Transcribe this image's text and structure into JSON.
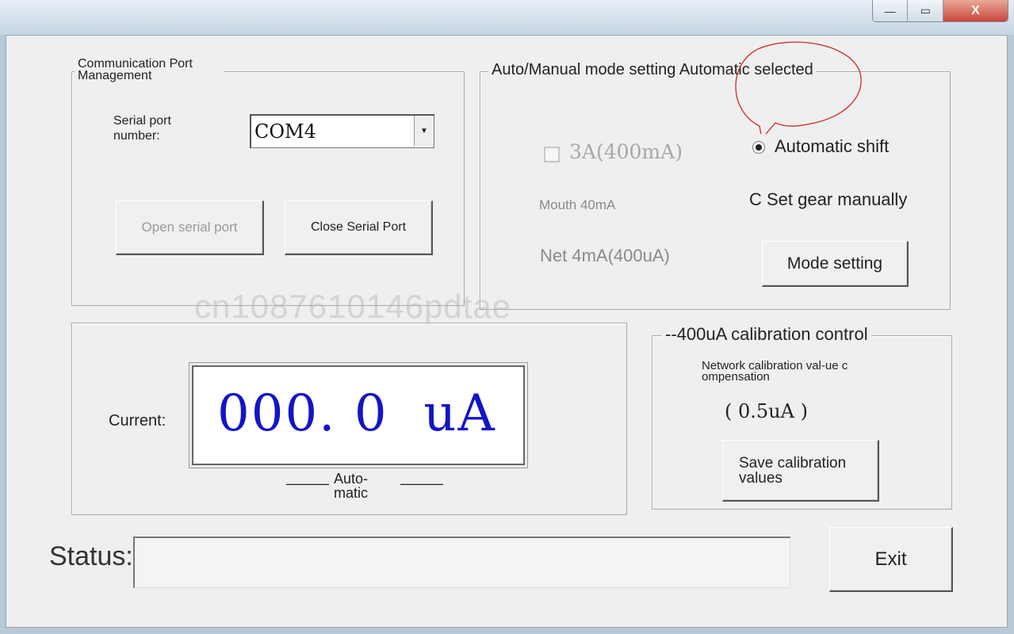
{
  "window": {
    "min_glyph": "—",
    "max_glyph": "▭",
    "close_glyph": "X"
  },
  "comm": {
    "legend": "Communication Port Management",
    "serial_label": "Serial port number:",
    "port_value": "COM4",
    "open_btn": "Open serial port",
    "close_btn": "Close Serial Port"
  },
  "mode": {
    "legend": "Auto/Manual mode setting Automatic selected",
    "checkbox_label": "3A(400mA)",
    "mouth_label": "Mouth 40mA",
    "net_label": "Net 4mA(400uA)",
    "auto_shift": "Automatic shift",
    "manual_gear": "C Set gear manually",
    "mode_btn": "Mode setting"
  },
  "current": {
    "label": "Current:",
    "value": "000. 0  uA",
    "dash_left": "———",
    "mode_text": "Auto-matic",
    "dash_right": "———"
  },
  "calibration": {
    "legend": "--400uA calibration control",
    "label": "Network calibration val-ue compensation",
    "value": "( 0.5uA )",
    "save_btn": "Save calibration values"
  },
  "status": {
    "label": "Status:",
    "value": ""
  },
  "exit_btn": "Exit",
  "watermark": "cn1087610146pdtae",
  "colors": {
    "display_digits": "#1414c8",
    "callout": "#cc2a2a"
  }
}
